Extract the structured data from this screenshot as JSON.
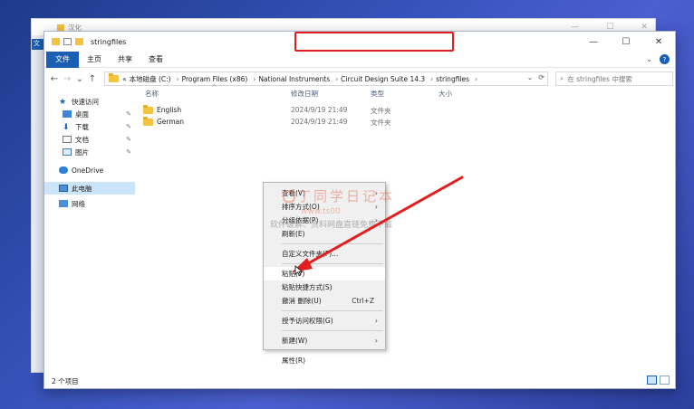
{
  "background_window": {
    "title": "汉化",
    "sidebar_tab": "文"
  },
  "window": {
    "title": "stringfiles",
    "controls": {
      "minimize": "—",
      "maximize": "☐",
      "close": "✕"
    }
  },
  "ribbon": {
    "tabs": [
      "文件",
      "主页",
      "共享",
      "查看"
    ],
    "expand": "⌄",
    "help": "?"
  },
  "nav_buttons": {
    "back": "←",
    "forward": "→",
    "recent": "⌄",
    "up": "↑"
  },
  "address": {
    "lead": "«",
    "crumbs": [
      "本地磁盘 (C:)",
      "Program Files (x86)",
      "National Instruments",
      "Circuit Design Suite 14.3",
      "stringfiles"
    ],
    "separator": "›",
    "dropdown": "⌄",
    "refresh": "⟳"
  },
  "search": {
    "placeholder": "在 stringfiles 中搜索"
  },
  "navigation": {
    "quick_access": "快速访问",
    "quick_items": [
      "桌面",
      "下载",
      "文档",
      "图片"
    ],
    "onedrive": "OneDrive",
    "this_pc": "此电脑",
    "network": "网络"
  },
  "columns": {
    "name": "名称",
    "date": "修改日期",
    "type": "类型",
    "size": "大小"
  },
  "files": [
    {
      "name": "English",
      "date": "2024/9/19 21:49",
      "type": "文件夹"
    },
    {
      "name": "German",
      "date": "2024/9/19 21:49",
      "type": "文件夹"
    }
  ],
  "status": {
    "count": "2 个项目"
  },
  "context_menu": {
    "view": "查看(V)",
    "sort": "排序方式(O)",
    "group": "分组依据(P)",
    "refresh": "刷新(E)",
    "customize": "自定义文件夹(F)...",
    "paste": "粘贴(P)",
    "paste_shortcut": "粘贴快捷方式(S)",
    "undo": "撤消 删除(U)",
    "undo_shortcut": "Ctrl+Z",
    "give_access": "授予访问权限(G)",
    "new": "新建(W)",
    "properties": "属性(R)"
  },
  "watermark": {
    "line1": "丁同学日记本",
    "line2": "www.ts00",
    "line3": "软件破解、资料网盘直链免费下载"
  },
  "colors": {
    "accent": "#1a5fb4",
    "highlight_box": "#e21f1f",
    "folder": "#f5c242"
  }
}
